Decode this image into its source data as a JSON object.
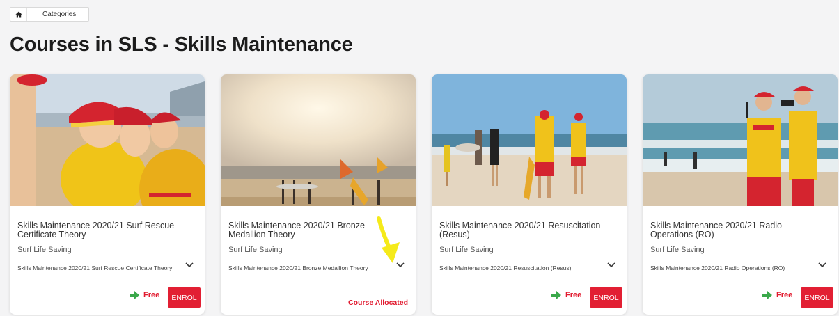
{
  "breadcrumb": {
    "home_icon": "home-icon",
    "categories": "Categories"
  },
  "page_title": "Courses in SLS - Skills Maintenance",
  "courses": [
    {
      "title": "Skills Maintenance 2020/21 Surf Rescue Certificate Theory",
      "provider": "Surf Life Saving",
      "selected": "Skills Maintenance 2020/21 Surf Rescue Certificate Theory",
      "price": "Free",
      "action": "ENROL"
    },
    {
      "title": "Skills Maintenance 2020/21 Bronze Medallion Theory",
      "provider": "Surf Life Saving",
      "selected": "Skills Maintenance 2020/21 Bronze Medallion Theory",
      "status": "Course Allocated"
    },
    {
      "title": "Skills Maintenance 2020/21 Resuscitation (Resus)",
      "provider": "Surf Life Saving",
      "selected": "Skills Maintenance 2020/21 Resuscitation (Resus)",
      "price": "Free",
      "action": "ENROL"
    },
    {
      "title": "Skills Maintenance 2020/21 Radio Operations (RO)",
      "provider": "Surf Life Saving",
      "selected": "Skills Maintenance 2020/21 Radio Operations (RO)",
      "price": "Free",
      "action": "ENROL"
    }
  ],
  "colors": {
    "accent_red": "#e21f33",
    "free_arrow_green": "#3aa84a",
    "annotation_yellow": "#f5ea1a"
  }
}
